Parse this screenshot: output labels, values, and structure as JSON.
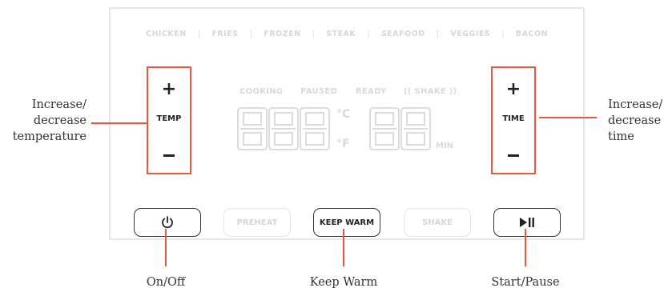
{
  "presets": [
    "CHICKEN",
    "FRIES",
    "FROZEN",
    "STEAK",
    "SEAFOOD",
    "VEGGIES",
    "BACON"
  ],
  "preset_separator": "|",
  "temp_control": {
    "plus": "+",
    "label": "TEMP",
    "minus": "−"
  },
  "time_control": {
    "plus": "+",
    "label": "TIME",
    "minus": "−"
  },
  "status": {
    "cooking": "COOKING",
    "paused": "PAUSED",
    "ready": "READY",
    "shake": "(( SHAKE ))"
  },
  "units": {
    "celsius": "°C",
    "fahrenheit": "°F",
    "minutes": "MIN"
  },
  "buttons": {
    "preheat": "PREHEAT",
    "keep_warm": "KEEP WARM",
    "shake": "SHAKE"
  },
  "callouts": {
    "left_lines": [
      "Increase/",
      "decrease",
      "temperature"
    ],
    "right_lines": [
      "Increase/",
      "decrease",
      "time"
    ],
    "on_off": "On/Off",
    "keep_warm": "Keep Warm",
    "start_pause": "Start/Pause"
  },
  "colors": {
    "accent": "#e8583a",
    "inactive": "#d9d9d9",
    "ink": "#222222"
  },
  "icons": {
    "power": "power-icon",
    "play_pause": "play-pause-icon"
  }
}
